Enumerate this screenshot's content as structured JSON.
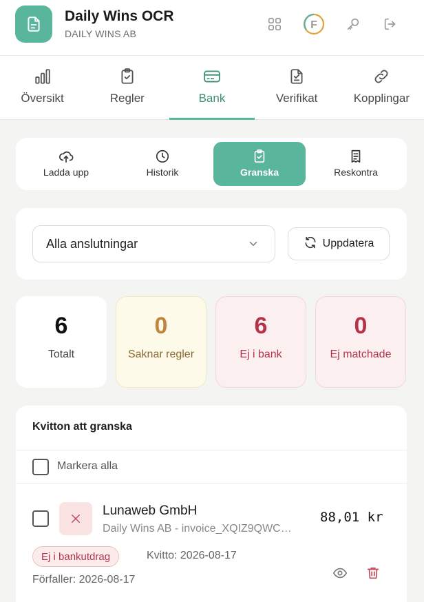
{
  "header": {
    "title": "Daily Wins OCR",
    "subtitle": "DAILY WINS AB",
    "icons": [
      "document-icon",
      "apps-grid-icon",
      "f-badge-icon",
      "key-icon",
      "logout-icon"
    ],
    "f_badge_letter": "F"
  },
  "main_tabs": [
    {
      "label": "Översikt",
      "icon": "bar-chart-icon",
      "active": false
    },
    {
      "label": "Regler",
      "icon": "clipboard-check-icon",
      "active": false
    },
    {
      "label": "Bank",
      "icon": "credit-card-icon",
      "active": true
    },
    {
      "label": "Verifikat",
      "icon": "file-check-icon",
      "active": false
    },
    {
      "label": "Kopplingar",
      "icon": "link-icon",
      "active": false
    }
  ],
  "sub_tabs": [
    {
      "label": "Ladda upp",
      "icon": "cloud-upload-icon",
      "active": false
    },
    {
      "label": "Historik",
      "icon": "clock-icon",
      "active": false
    },
    {
      "label": "Granska",
      "icon": "clipboard-check-icon",
      "active": true
    },
    {
      "label": "Reskontra",
      "icon": "receipt-icon",
      "active": false
    }
  ],
  "filter": {
    "connection_selected": "Alla anslutningar",
    "refresh_label": "Uppdatera"
  },
  "stats": [
    {
      "value": "6",
      "label": "Totalt"
    },
    {
      "value": "0",
      "label": "Saknar regler"
    },
    {
      "value": "6",
      "label": "Ej i bank"
    },
    {
      "value": "0",
      "label": "Ej matchade"
    }
  ],
  "list": {
    "title": "Kvitton att granska",
    "select_all_label": "Markera alla",
    "items": [
      {
        "vendor": "Lunaweb GmbH",
        "file": "Daily Wins AB - invoice_XQIZ9QWC…",
        "amount": "88,01 kr",
        "badge": "Ej i bankutdrag",
        "receipt_date": "Kvitto: 2026-08-17",
        "due_date": "Förfaller: 2026-08-17"
      }
    ]
  },
  "colors": {
    "accent": "#5ab59d",
    "accent_text": "#3e8f78",
    "danger": "#b3344a",
    "warning": "#c0843c"
  }
}
